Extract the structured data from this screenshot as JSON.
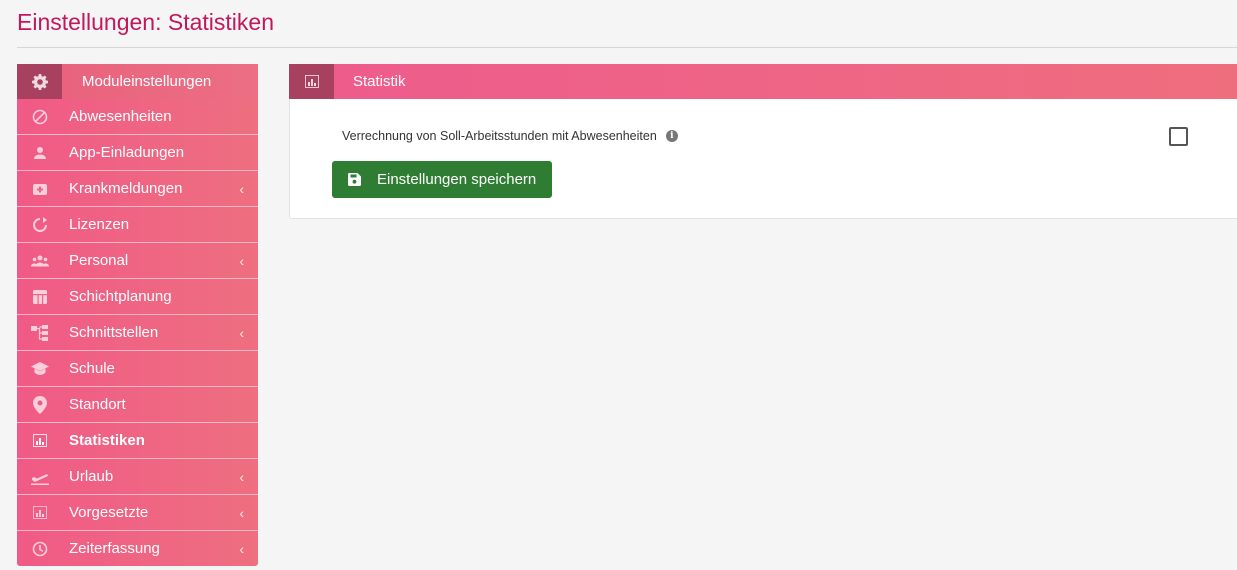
{
  "page": {
    "title": "Einstellungen: Statistiken"
  },
  "sidebar": {
    "header": {
      "label": "Moduleinstellungen",
      "icon": "gear-icon"
    },
    "items": [
      {
        "label": "Abwesenheiten",
        "icon": "block-icon",
        "has_submenu": false
      },
      {
        "label": "App-Einladungen",
        "icon": "person-icon",
        "has_submenu": false
      },
      {
        "label": "Krankmeldungen",
        "icon": "medical-kit-icon",
        "has_submenu": true
      },
      {
        "label": "Lizenzen",
        "icon": "refresh-icon",
        "has_submenu": false
      },
      {
        "label": "Personal",
        "icon": "group-icon",
        "has_submenu": true
      },
      {
        "label": "Schichtplanung",
        "icon": "calendar-table-icon",
        "has_submenu": false
      },
      {
        "label": "Schnittstellen",
        "icon": "hierarchy-icon",
        "has_submenu": true
      },
      {
        "label": "Schule",
        "icon": "graduation-cap-icon",
        "has_submenu": false
      },
      {
        "label": "Standort",
        "icon": "location-pin-icon",
        "has_submenu": false
      },
      {
        "label": "Statistiken",
        "icon": "bar-chart-icon",
        "has_submenu": false,
        "active": true
      },
      {
        "label": "Urlaub",
        "icon": "plane-icon",
        "has_submenu": true
      },
      {
        "label": "Vorgesetzte",
        "icon": "bar-chart-icon",
        "has_submenu": true
      },
      {
        "label": "Zeiterfassung",
        "icon": "clock-icon",
        "has_submenu": true
      }
    ],
    "chevron": "‹"
  },
  "panel": {
    "title": "Statistik",
    "icon": "bar-chart-icon",
    "setting_label": "Verrechnung von Soll-Arbeitsstunden mit Abwesenheiten",
    "info_glyph": "i",
    "checkbox_checked": false,
    "save_label": "Einstellungen speichern"
  },
  "colors": {
    "accent": "#c2185b",
    "sidebar_header_icon_bg": "#a8415f",
    "save_button": "#2e7d32"
  }
}
